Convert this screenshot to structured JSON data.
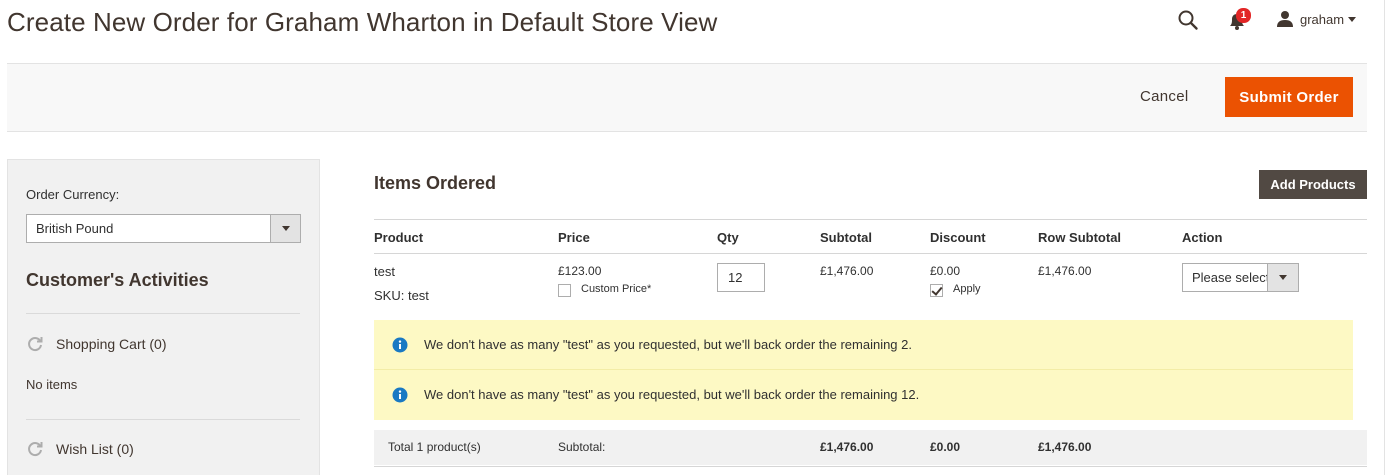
{
  "header": {
    "title": "Create New Order for Graham Wharton in Default Store View",
    "notifications_count": "1",
    "user_name": "graham",
    "icons": [
      "search-icon",
      "bell-icon",
      "user-icon",
      "caret-down-icon"
    ]
  },
  "actions": {
    "cancel_label": "Cancel",
    "submit_label": "Submit Order"
  },
  "sidebar": {
    "currency_label": "Order Currency:",
    "currency_value": "British Pound",
    "activities_title": "Customer's Activities",
    "shopping_cart_label": "Shopping Cart (0)",
    "no_items": "No items",
    "wish_list_label": "Wish List (0)"
  },
  "items": {
    "title": "Items Ordered",
    "add_products_label": "Add Products",
    "columns": [
      "Product",
      "Price",
      "Qty",
      "Subtotal",
      "Discount",
      "Row Subtotal",
      "Action"
    ],
    "rows": [
      {
        "product": "test",
        "sku": "SKU: test",
        "price": "£123.00",
        "custom_price_label": "Custom Price*",
        "qty": "12",
        "subtotal": "£1,476.00",
        "discount": "£0.00",
        "apply_label": "Apply",
        "row_subtotal": "£1,476.00",
        "action_placeholder": "Please select"
      }
    ],
    "notices": [
      "We don't have as many \"test\" as you requested, but we'll back order the remaining 2.",
      "We don't have as many \"test\" as you requested, but we'll back order the remaining 12."
    ],
    "totals": {
      "label": "Total 1 product(s)",
      "subtotal_label": "Subtotal:",
      "subtotal": "£1,476.00",
      "discount": "£0.00",
      "row_subtotal": "£1,476.00"
    }
  },
  "colors": {
    "primary_button": "#eb5202",
    "secondary_button": "#514943",
    "notice_bg": "#fdf9c4",
    "info_icon": "#1979c3",
    "badge": "#e22626"
  }
}
